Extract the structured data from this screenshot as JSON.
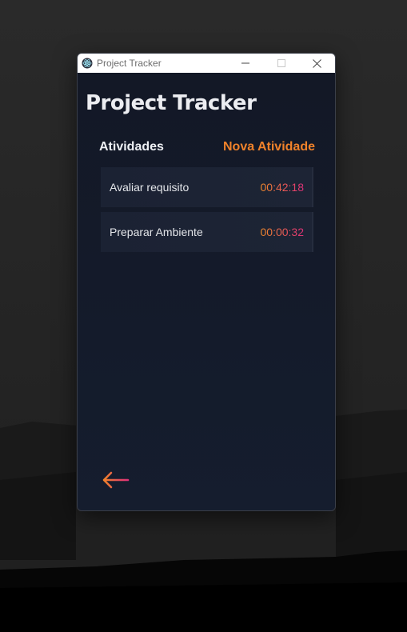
{
  "window": {
    "title": "Project Tracker",
    "app_icon": "electron-icon"
  },
  "page": {
    "title": "Project Tracker"
  },
  "activities_section": {
    "title": "Atividades",
    "new_label": "Nova Atividade"
  },
  "activities": [
    {
      "name": "Avaliar requisito",
      "time": "00:42:18"
    },
    {
      "name": "Preparar Ambiente",
      "time": "00:00:32"
    }
  ],
  "back_button": {
    "icon": "arrow-left-icon"
  },
  "colors": {
    "background": "#131826",
    "accent_orange": "#f0822a",
    "accent_pink": "#e0307a",
    "card": "#1b2233",
    "text": "#ecedf1"
  }
}
